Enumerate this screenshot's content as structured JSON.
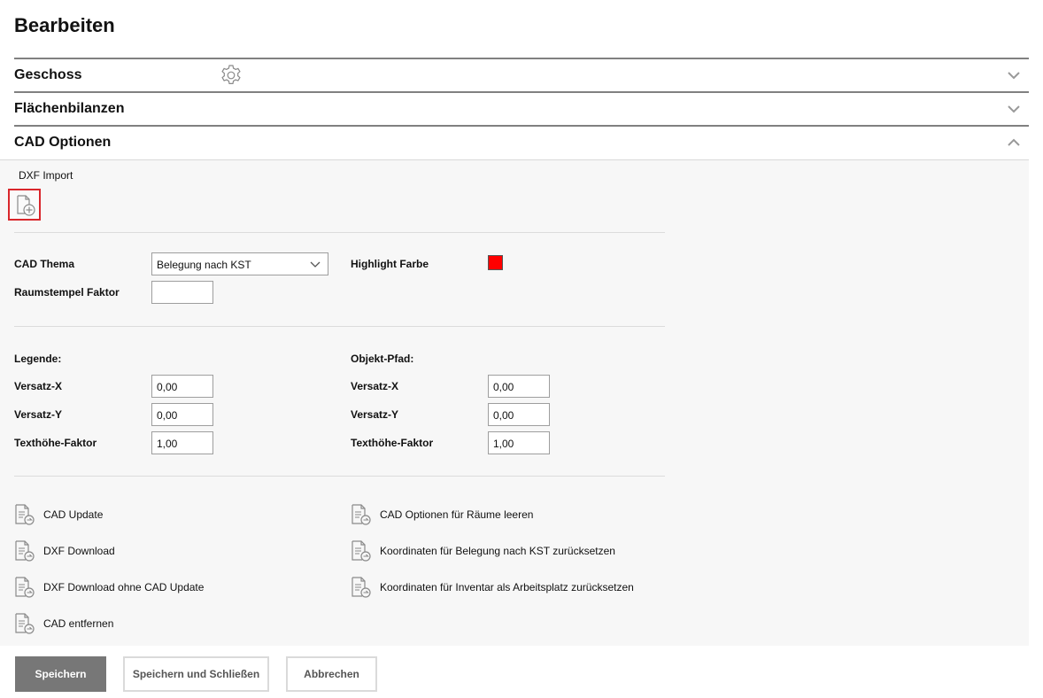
{
  "page": {
    "title": "Bearbeiten"
  },
  "sections": {
    "geschoss": "Geschoss",
    "flaechenbilanzen": "Flächenbilanzen",
    "cad_optionen": "CAD Optionen"
  },
  "cad": {
    "dxf_import_label": "DXF Import",
    "thema_label": "CAD Thema",
    "thema_value": "Belegung nach KST",
    "raumstempel_label": "Raumstempel Faktor",
    "raumstempel_value": "",
    "highlight_label": "Highlight Farbe",
    "highlight_color": "#ff0000",
    "legende": {
      "title": "Legende:",
      "versatz_x_label": "Versatz-X",
      "versatz_x": "0,00",
      "versatz_y_label": "Versatz-Y",
      "versatz_y": "0,00",
      "texthoehe_label": "Texthöhe-Faktor",
      "texthoehe": "1,00"
    },
    "objekt_pfad": {
      "title": "Objekt-Pfad:",
      "versatz_x_label": "Versatz-X",
      "versatz_x": "0,00",
      "versatz_y_label": "Versatz-Y",
      "versatz_y": "0,00",
      "texthoehe_label": "Texthöhe-Faktor",
      "texthoehe": "1,00"
    },
    "actions_left": [
      "CAD Update",
      "DXF Download",
      "DXF Download ohne CAD Update",
      "CAD entfernen"
    ],
    "actions_right": [
      "CAD Optionen für Räume leeren",
      "Koordinaten für Belegung nach KST zurücksetzen",
      "Koordinaten für Inventar als Arbeitsplatz zurücksetzen"
    ]
  },
  "buttons": {
    "save": "Speichern",
    "save_close": "Speichern und Schließen",
    "cancel": "Abbrechen"
  },
  "icons": {
    "gear": "gear-icon",
    "chevron_down": "chevron-down-icon",
    "chevron_up": "chevron-up-icon",
    "file_add": "file-add-icon",
    "document_action": "document-arrow-icon"
  },
  "colors": {
    "accent_red": "#d9262b",
    "primary_button": "#777777"
  }
}
